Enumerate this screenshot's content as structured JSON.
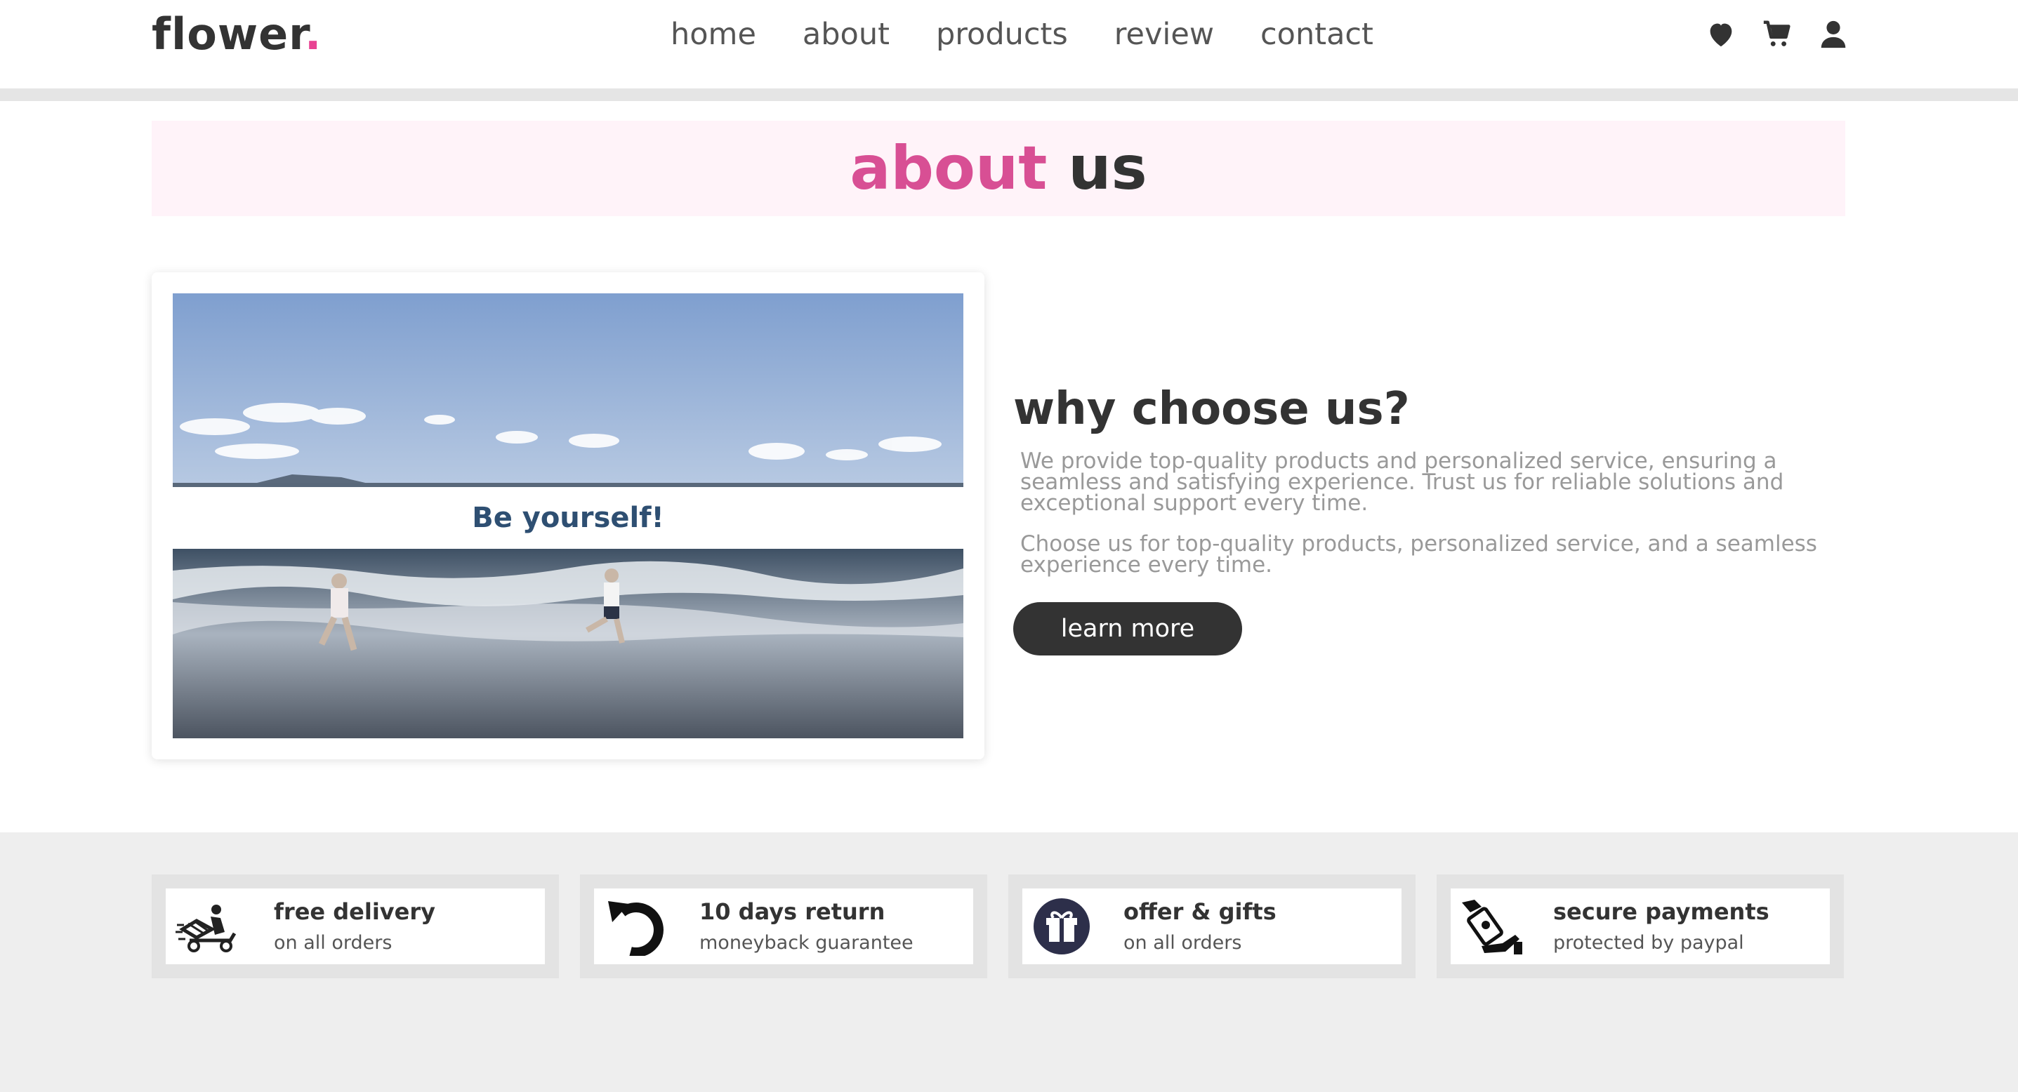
{
  "header": {
    "logo": "flower",
    "logo_dot": ".",
    "nav": [
      "home",
      "about",
      "products",
      "review",
      "contact"
    ],
    "icons": [
      "heart-icon",
      "cart-icon",
      "user-icon"
    ]
  },
  "about": {
    "title_accent": "about",
    "title_rest": " us",
    "image_caption": "Be yourself!",
    "heading": "why choose us?",
    "paragraphs": [
      "We provide top-quality products and personalized service, ensuring a seamless and satisfying experience. Trust us for reliable solutions and exceptional support every time.",
      "Choose us for top-quality products, personalized service, and a seamless experience every time."
    ],
    "button": "learn more"
  },
  "features": [
    {
      "icon": "delivery-scooter-icon",
      "title": "free delivery",
      "subtitle": "on all orders"
    },
    {
      "icon": "return-arrow-icon",
      "title": "10 days return",
      "subtitle": "moneyback guarantee"
    },
    {
      "icon": "gift-icon",
      "title": "offer & gifts",
      "subtitle": "on all orders"
    },
    {
      "icon": "hand-money-icon",
      "title": "secure payments",
      "subtitle": "protected by paypal"
    }
  ],
  "colors": {
    "accent": "#d84f94",
    "dark": "#333333",
    "muted_text": "#999999",
    "title_bg": "#fff3f9"
  }
}
